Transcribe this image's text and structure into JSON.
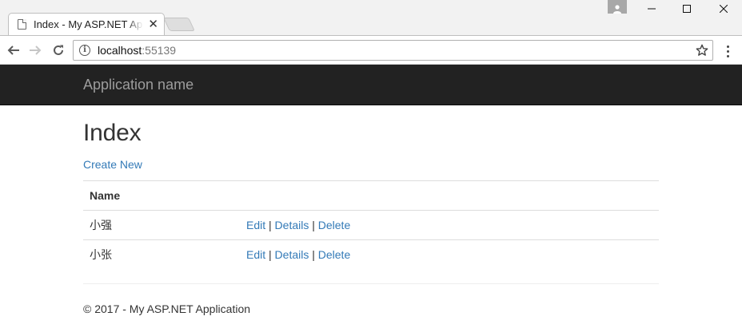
{
  "browser": {
    "tab_title": "Index - My ASP.NET Application",
    "tab_close": "✕",
    "url_host": "localhost",
    "url_port": ":55139",
    "window_controls": {
      "minimize": "—",
      "maximize": "☐",
      "close": "✕"
    }
  },
  "navbar": {
    "brand": "Application name"
  },
  "page": {
    "title": "Index",
    "create_link": "Create New",
    "table": {
      "headers": [
        "Name"
      ],
      "rows": [
        {
          "name": "小强",
          "edit": "Edit",
          "details": "Details",
          "delete": "Delete",
          "sep": "|"
        },
        {
          "name": "小张",
          "edit": "Edit",
          "details": "Details",
          "delete": "Delete",
          "sep": "|"
        }
      ]
    }
  },
  "footer": {
    "text": "© 2017 - My ASP.NET Application"
  },
  "colors": {
    "navbar_bg": "#222222",
    "brand": "#9d9d9d",
    "link": "#337ab7"
  },
  "icons": [
    "page-icon",
    "profile-icon",
    "back-arrow-icon",
    "forward-arrow-icon",
    "reload-icon",
    "info-icon",
    "star-icon",
    "menu-dots-icon"
  ]
}
